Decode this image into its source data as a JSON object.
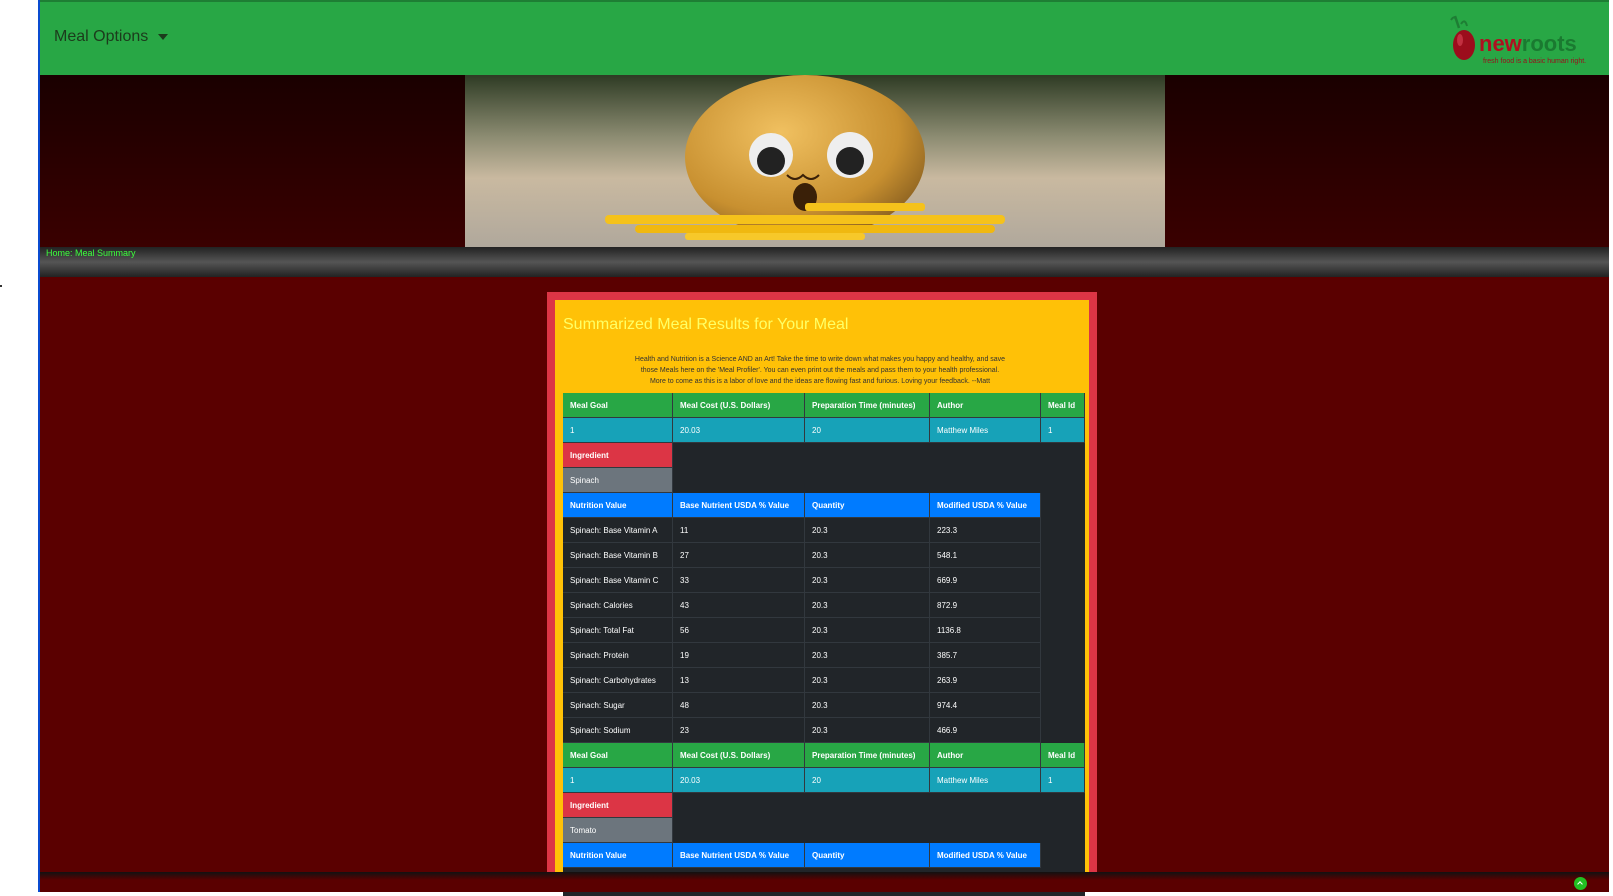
{
  "navbar": {
    "menu_label": "Meal Options",
    "logo_word_1": "new",
    "logo_word_2": "roots",
    "logo_tagline": "fresh food is a basic human right."
  },
  "breadcrumb": "Home: Meal Summary",
  "card": {
    "title": "Summarized Meal Results for Your Meal",
    "intro_lines": [
      "Health and Nutrition is a Science AND an Art! Take the time to write down what makes you happy and healthy, and save",
      "those Meals here on the 'Meal Profiler'. You can even print out the meals and pass them to your health professional.",
      "More to come as this is a labor of love and the ideas are flowing fast and furious. Loving your feedback. --Matt"
    ]
  },
  "meal_headers": [
    "Meal Goal",
    "Meal Cost (U.S. Dollars)",
    "Preparation Time (minutes)",
    "Author",
    "Meal Id"
  ],
  "nutrition_headers": [
    "Nutrition Value",
    "Base Nutrient USDA % Value",
    "Quantity",
    "Modified USDA % Value"
  ],
  "ingredient_label": "Ingredient",
  "meals": [
    {
      "values": [
        "1",
        "20.03",
        "20",
        "Matthew Miles",
        "1"
      ],
      "ingredient": "Spinach",
      "nutrition": [
        [
          "Spinach: Base Vitamin A",
          "11",
          "20.3",
          "223.3"
        ],
        [
          "Spinach: Base Vitamin B",
          "27",
          "20.3",
          "548.1"
        ],
        [
          "Spinach: Base Vitamin C",
          "33",
          "20.3",
          "669.9"
        ],
        [
          "Spinach: Calories",
          "43",
          "20.3",
          "872.9"
        ],
        [
          "Spinach: Total Fat",
          "56",
          "20.3",
          "1136.8"
        ],
        [
          "Spinach: Protein",
          "19",
          "20.3",
          "385.7"
        ],
        [
          "Spinach: Carbohydrates",
          "13",
          "20.3",
          "263.9"
        ],
        [
          "Spinach: Sugar",
          "48",
          "20.3",
          "974.4"
        ],
        [
          "Spinach: Sodium",
          "23",
          "20.3",
          "466.9"
        ]
      ]
    },
    {
      "values": [
        "1",
        "20.03",
        "20",
        "Matthew Miles",
        "1"
      ],
      "ingredient": "Tomato",
      "nutrition": []
    }
  ],
  "colors": {
    "navbar": "#28a745",
    "page_bg": "#5a0000",
    "card_border": "#dc3545",
    "card_bg": "#ffc107",
    "header_green": "#28a745",
    "values_teal": "#17a2b8",
    "ingredient_red": "#dc3545",
    "ingredient_gray": "#6c757d",
    "nutrition_blue": "#007bff",
    "table_dark": "#212529"
  },
  "icons": {
    "menu_toggle": "caret-down-icon",
    "scroll_top": "arrow-up-circle-icon"
  }
}
